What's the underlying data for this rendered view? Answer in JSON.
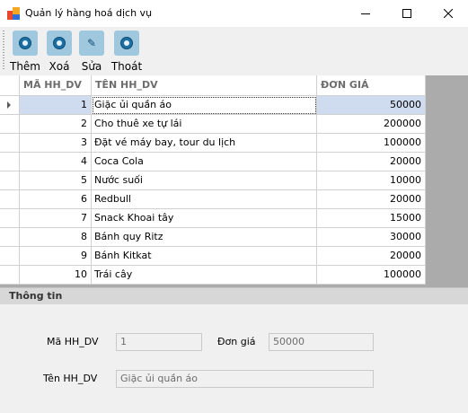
{
  "window": {
    "title": "Quản lý hàng hoá dịch vụ"
  },
  "toolbar": {
    "buttons": [
      {
        "label": "Thêm",
        "icon": "camera-icon"
      },
      {
        "label": "Xoá",
        "icon": "camera-icon"
      },
      {
        "label": "Sửa",
        "icon": "edit-icon"
      },
      {
        "label": "Thoát",
        "icon": "camera-icon"
      }
    ]
  },
  "grid": {
    "columns": [
      "MÃ HH_DV",
      "TÊN HH_DV",
      "ĐƠN GIÁ"
    ],
    "rows": [
      {
        "id": "1",
        "name": "Giặc ủi quần áo",
        "price": "50000"
      },
      {
        "id": "2",
        "name": "Cho thuê xe tự lái",
        "price": "200000"
      },
      {
        "id": "3",
        "name": "Đặt vé máy bay, tour du lịch",
        "price": "100000"
      },
      {
        "id": "4",
        "name": "Coca Cola",
        "price": "20000"
      },
      {
        "id": "5",
        "name": "Nước suối",
        "price": "10000"
      },
      {
        "id": "6",
        "name": "Redbull",
        "price": "20000"
      },
      {
        "id": "7",
        "name": "Snack Khoai tây",
        "price": "15000"
      },
      {
        "id": "8",
        "name": "Bánh quy Ritz",
        "price": "30000"
      },
      {
        "id": "9",
        "name": "Bánh Kitkat",
        "price": "20000"
      },
      {
        "id": "10",
        "name": "Trái cây",
        "price": "100000"
      }
    ]
  },
  "info": {
    "title": "Thông tin",
    "ma_label": "Mã HH_DV",
    "ma_value": "1",
    "dongia_label": "Đơn giá",
    "dongia_value": "50000",
    "ten_label": "Tên HH_DV",
    "ten_value": "Giặc ủi quần áo"
  }
}
